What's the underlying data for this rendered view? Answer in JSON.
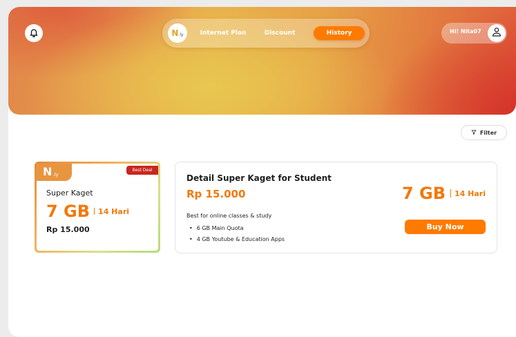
{
  "header": {
    "brand": {
      "mark": "N",
      "suffix": ".ly"
    },
    "nav": {
      "internet_plan": "Internet Plan",
      "discount": "Discount",
      "history": "History"
    },
    "greeting": "Hi! Nita07"
  },
  "toolbar": {
    "filter_label": "Filter"
  },
  "plan_card": {
    "logo_mark": "N",
    "logo_suffix": ".ly",
    "badge": "Best Deal",
    "title": "Super Kaget",
    "quota": "7 GB",
    "duration": "14 Hari",
    "price": "Rp 15.000"
  },
  "detail": {
    "title": "Detail Super Kaget for Student",
    "price": "Rp 15.000",
    "quota": "7 GB",
    "duration": "14 Hari",
    "description": "Best for online classes & study",
    "features": [
      "6 GB Main Quota",
      "4 GB Youtube & Education Apps"
    ],
    "buy_label": "Buy Now"
  },
  "colors": {
    "accent": "#ff7a00",
    "badge": "#c9261f"
  }
}
